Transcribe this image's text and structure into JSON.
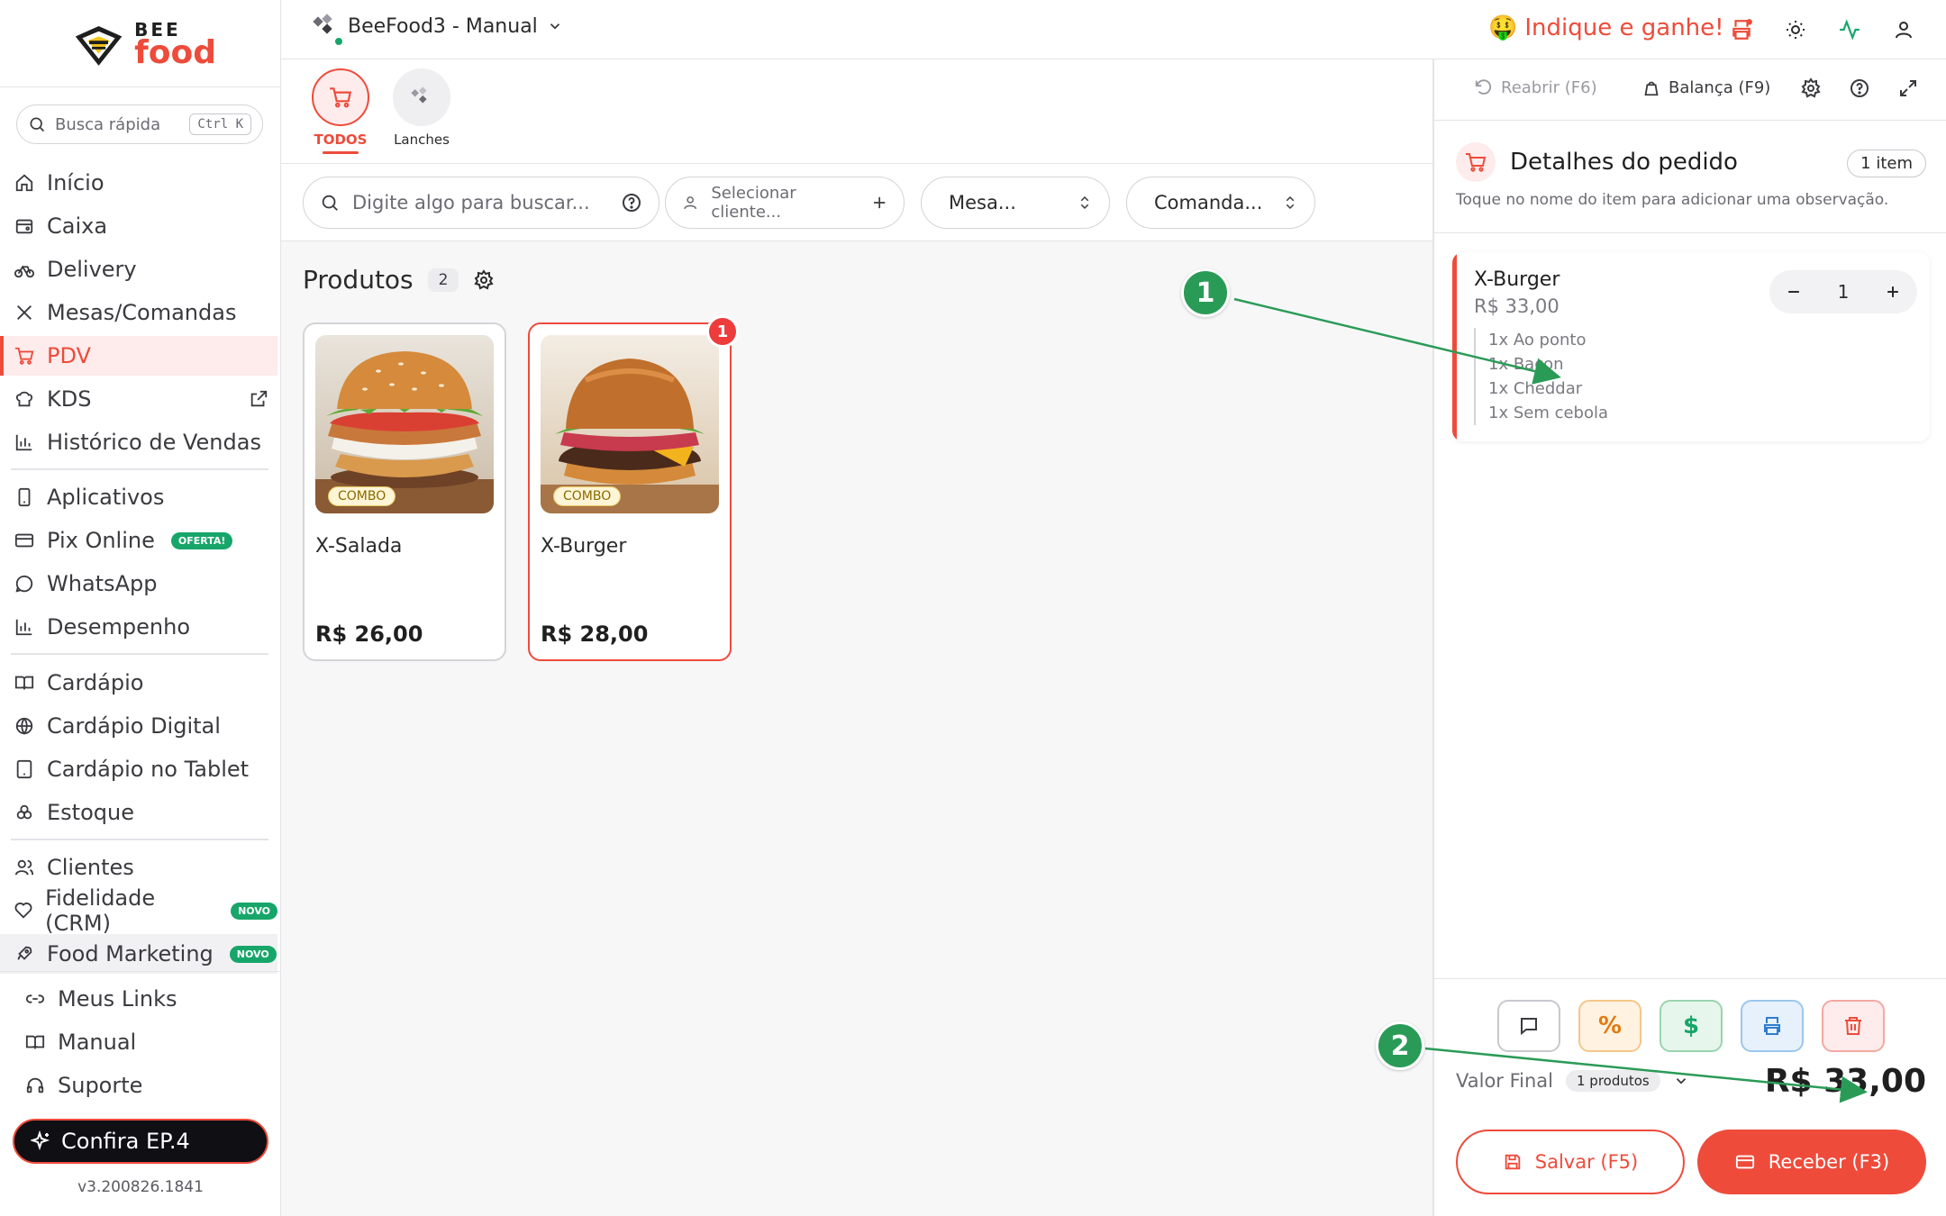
{
  "app": {
    "logo_top": "BEE",
    "logo_bottom": "food",
    "store_name": "BeeFood3 - Manual",
    "version": "v3.200826.1841"
  },
  "colors": {
    "accent": "#ee4b3b",
    "green": "#17a66a",
    "callout": "#2a9b57"
  },
  "topbar": {
    "indique_emoji": "🤑",
    "indique_label": "Indique e ganhe!",
    "icons": [
      "printer-icon",
      "sun-icon",
      "activity-icon",
      "user-icon"
    ]
  },
  "sidebar": {
    "search": {
      "placeholder": "Busca rápida",
      "shortcut": "Ctrl K"
    },
    "items": [
      {
        "label": "Início",
        "icon": "home-icon"
      },
      {
        "label": "Caixa",
        "icon": "cash-register-icon"
      },
      {
        "label": "Delivery",
        "icon": "bike-icon"
      },
      {
        "label": "Mesas/Comandas",
        "icon": "utensils-icon"
      },
      {
        "label": "PDV",
        "icon": "cart-icon",
        "active": true
      },
      {
        "label": "KDS",
        "icon": "chef-hat-icon"
      },
      {
        "label": "Histórico de Vendas",
        "icon": "bar-chart-icon"
      },
      {
        "label": "Aplicativos",
        "icon": "smartphone-icon"
      },
      {
        "label": "Pix Online",
        "icon": "credit-card-icon",
        "badge": "OFERTA!"
      },
      {
        "label": "WhatsApp",
        "icon": "message-circle-icon"
      },
      {
        "label": "Desempenho",
        "icon": "bar-chart-icon"
      },
      {
        "label": "Cardápio",
        "icon": "book-open-icon"
      },
      {
        "label": "Cardápio Digital",
        "icon": "globe-icon"
      },
      {
        "label": "Cardápio no Tablet",
        "icon": "tablet-icon"
      },
      {
        "label": "Estoque",
        "icon": "boxes-icon"
      },
      {
        "label": "Clientes",
        "icon": "users-icon"
      },
      {
        "label": "Fidelidade (CRM)",
        "icon": "heart-icon",
        "badge": "NOVO"
      },
      {
        "label": "Food Marketing",
        "icon": "rocket-icon",
        "badge": "NOVO"
      }
    ],
    "bottom_items": [
      {
        "label": "Meus Links",
        "icon": "link-icon"
      },
      {
        "label": "Manual",
        "icon": "book-icon"
      },
      {
        "label": "Suporte",
        "icon": "headphones-icon"
      }
    ],
    "promo_label": "Confira EP.4"
  },
  "categories": [
    {
      "label": "TODOS",
      "icon": "cart-icon",
      "active": true
    },
    {
      "label": "Lanches",
      "icon": "category-logo-icon",
      "active": false
    }
  ],
  "filters": {
    "search_placeholder": "Digite algo para buscar...",
    "client_placeholder": "Selecionar cliente...",
    "mesa_label": "Mesa...",
    "comanda_label": "Comanda..."
  },
  "products": {
    "heading": "Produtos",
    "count": "2",
    "items": [
      {
        "name": "X-Salada",
        "price": "R$ 26,00",
        "tag": "COMBO",
        "selected": false,
        "qty": ""
      },
      {
        "name": "X-Burger",
        "price": "R$ 28,00",
        "tag": "COMBO",
        "selected": true,
        "qty": "1"
      }
    ]
  },
  "order": {
    "tools": {
      "reopen": "Reabrir (F6)",
      "scale": "Balança (F9)"
    },
    "title": "Detalhes do pedido",
    "item_count": "1 item",
    "subtitle": "Toque no nome do item para adicionar uma observação.",
    "items": [
      {
        "name": "X-Burger",
        "price": "R$ 33,00",
        "qty": "1",
        "modifiers": [
          "1x Ao ponto",
          "1x Bacon",
          "1x Cheddar",
          "1x Sem cebola"
        ]
      }
    ],
    "actions": [
      {
        "icon": "comment-icon",
        "label": "",
        "bg": "#ffffff",
        "border": "#c8c8ce",
        "color": "#3a3a3f"
      },
      {
        "icon": "percent-icon",
        "label": "%",
        "bg": "#fff2e0",
        "border": "#f5c68a",
        "color": "#e07a10"
      },
      {
        "icon": "dollar-icon",
        "label": "$",
        "bg": "#e6f6ec",
        "border": "#9ad4b0",
        "color": "#17a66a"
      },
      {
        "icon": "printer-icon",
        "label": "",
        "bg": "#e6f1fb",
        "border": "#9cc7ee",
        "color": "#2e7cd0"
      },
      {
        "icon": "trash-icon",
        "label": "",
        "bg": "#fdeceb",
        "border": "#f2a9a2",
        "color": "#ee4b3b"
      }
    ],
    "total_label": "Valor Final",
    "total_badge": "1 produtos",
    "total_value": "R$ 33,00",
    "save_label": "Salvar (F5)",
    "receive_label": "Receber (F3)"
  },
  "annotations": [
    {
      "number": "1",
      "target": "order-item-modifiers"
    },
    {
      "number": "2",
      "target": "order-total"
    }
  ]
}
